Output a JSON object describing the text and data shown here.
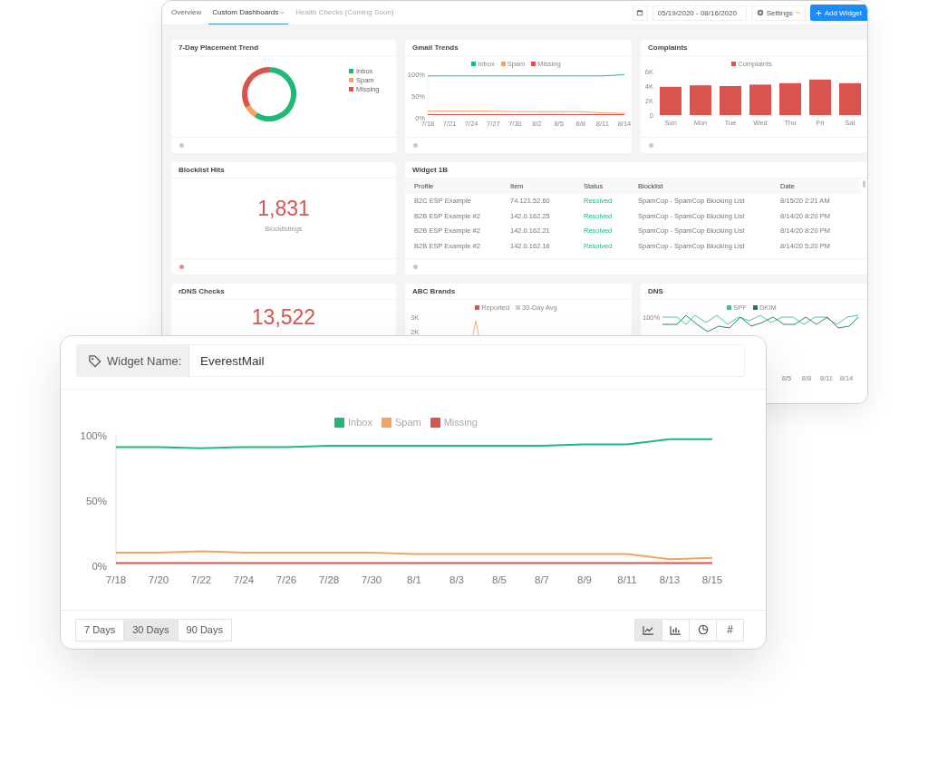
{
  "dashboard": {
    "tabs": [
      {
        "label": "Overview",
        "selected": false,
        "disabled": false,
        "dropdown": false
      },
      {
        "label": "Custom Dashboards",
        "selected": true,
        "disabled": false,
        "dropdown": true
      },
      {
        "label": "Health Checks (Coming Soon)",
        "selected": false,
        "disabled": true,
        "dropdown": false
      }
    ],
    "date_range": "05/19/2020 - 08/16/2020",
    "settings_label": "Settings",
    "add_widget_label": "Add Widget",
    "widgets": [
      {
        "kind": "donut",
        "title": "7-Day Placement Trend",
        "color": "#c8c8c8",
        "legend": [
          {
            "label": "Inbox",
            "color": "#1fb877"
          },
          {
            "label": "Spam",
            "color": "#f5a25d"
          },
          {
            "label": "Missing",
            "color": "#d9534f"
          }
        ]
      },
      {
        "kind": "line",
        "title": "Gmail Trends",
        "color": "#c8c8c8",
        "chart_data": {
          "type": "line",
          "legend": "top",
          "categories": [
            "7/18",
            "7/21",
            "7/24",
            "7/27",
            "7/30",
            "8/2",
            "8/5",
            "8/8",
            "8/11",
            "8/14"
          ],
          "ylim": [
            0,
            1
          ],
          "yticks": [
            {
              "value": 0,
              "label": "0%"
            },
            {
              "value": 0.5,
              "label": "50%"
            },
            {
              "value": 1,
              "label": "100%"
            }
          ],
          "series": [
            {
              "name": "Inbox",
              "color": "#1fb877",
              "values": [
                0.9,
                0.9,
                0.9,
                0.9,
                0.9,
                0.9,
                0.9,
                0.9,
                0.9,
                0.93
              ]
            },
            {
              "name": "Spam",
              "color": "#f5a25d",
              "values": [
                0.09,
                0.09,
                0.09,
                0.09,
                0.08,
                0.08,
                0.08,
                0.08,
                0.05,
                0.04
              ]
            },
            {
              "name": "Missing",
              "color": "#d9534f",
              "values": [
                0.01,
                0.01,
                0.01,
                0.01,
                0.01,
                0.01,
                0.01,
                0.01,
                0.01,
                0.01
              ]
            }
          ]
        }
      },
      {
        "kind": "bar",
        "title": "Complaints",
        "color": "#c8c8c8",
        "chart_data": {
          "type": "bar",
          "legend": "top",
          "categories": [
            "Sun",
            "Mon",
            "Tue",
            "Wed",
            "Thu",
            "Fri",
            "Sat"
          ],
          "ylim": [
            0,
            6000
          ],
          "yticks": [
            {
              "value": 0,
              "label": "0"
            },
            {
              "value": 2000,
              "label": "2K"
            },
            {
              "value": 4000,
              "label": "4K"
            },
            {
              "value": 6000,
              "label": "6K"
            }
          ],
          "series": [
            {
              "name": "Complaints",
              "color": "#d9534f",
              "values": [
                3900,
                4100,
                4000,
                4200,
                4400,
                4900,
                4400
              ]
            }
          ]
        }
      },
      {
        "kind": "stat",
        "title": "Blocklist Hits",
        "value": "1,831",
        "caption": "Blocklistings",
        "color": "#e58c8c"
      },
      {
        "kind": "table",
        "title": "Widget 1B",
        "color": "#c8c8c8",
        "columns": [
          "Profile",
          "Item",
          "Status",
          "Blocklist",
          "Date"
        ],
        "rows": [
          [
            "B2C ESP Example",
            "74.121.52.60",
            "Resolved",
            "SpamCop - SpamCop Blocking List",
            "8/15/20 2:21 AM"
          ],
          [
            "B2B ESP Example #2",
            "142.0.162.25",
            "Resolved",
            "SpamCop - SpamCop Blocking List",
            "8/14/20 8:20 PM"
          ],
          [
            "B2B ESP Example #2",
            "142.0.162.21",
            "Resolved",
            "SpamCop - SpamCop Blocking List",
            "8/14/20 8:20 PM"
          ],
          [
            "B2B ESP Example #2",
            "142.0.162.16",
            "Resolved",
            "SpamCop - SpamCop Blocking List",
            "8/14/20 5:20 PM"
          ]
        ]
      },
      {
        "kind": "stat",
        "title": "rDNS Checks",
        "value": "13,522"
      },
      {
        "kind": "spike",
        "title": "ABC Brands",
        "legend": [
          {
            "label": "Reported",
            "color": "#d9534f"
          },
          {
            "label": "30-Day Avg",
            "color": "#cccccc"
          }
        ],
        "yticks": [
          "3K",
          "2K"
        ]
      },
      {
        "kind": "dns",
        "title": "DNS",
        "legend": [
          {
            "label": "SPF",
            "color": "#3cc38a"
          },
          {
            "label": "DKIM",
            "color": "#1e7a55"
          }
        ],
        "yticks": [
          "100%"
        ],
        "xlabels": [
          "8/5",
          "8/8",
          "8/11",
          "8/14"
        ]
      }
    ]
  },
  "editor": {
    "name_label": "Widget Name:",
    "name_value": "EverestMail",
    "chart_data": {
      "type": "line",
      "legend": "top",
      "categories": [
        "7/18",
        "7/20",
        "7/22",
        "7/24",
        "7/26",
        "7/28",
        "7/30",
        "8/1",
        "8/3",
        "8/5",
        "8/7",
        "8/9",
        "8/11",
        "8/13",
        "8/15"
      ],
      "ylim": [
        0,
        1
      ],
      "yticks": [
        {
          "value": 0,
          "label": "0%"
        },
        {
          "value": 0.5,
          "label": "50%"
        },
        {
          "value": 1,
          "label": "100%"
        }
      ],
      "series": [
        {
          "name": "Inbox",
          "color": "#1fb877",
          "values": [
            0.9,
            0.9,
            0.89,
            0.9,
            0.9,
            0.91,
            0.91,
            0.91,
            0.91,
            0.91,
            0.91,
            0.92,
            0.92,
            0.96,
            0.96
          ]
        },
        {
          "name": "Spam",
          "color": "#f5a25d",
          "values": [
            0.09,
            0.09,
            0.1,
            0.09,
            0.09,
            0.09,
            0.09,
            0.08,
            0.08,
            0.08,
            0.08,
            0.08,
            0.08,
            0.04,
            0.05
          ]
        },
        {
          "name": "Missing",
          "color": "#d9534f",
          "values": [
            0.01,
            0.01,
            0.01,
            0.01,
            0.01,
            0.01,
            0.01,
            0.01,
            0.01,
            0.01,
            0.01,
            0.01,
            0.01,
            0.01,
            0.01
          ]
        }
      ]
    },
    "ranges": [
      {
        "label": "7 Days",
        "selected": false
      },
      {
        "label": "30 Days",
        "selected": true
      },
      {
        "label": "90 Days",
        "selected": false
      }
    ],
    "chart_types": [
      {
        "kind": "line",
        "selected": true
      },
      {
        "kind": "bar",
        "selected": false
      },
      {
        "kind": "pie",
        "selected": false
      },
      {
        "kind": "number",
        "label": "#",
        "selected": false
      }
    ]
  }
}
